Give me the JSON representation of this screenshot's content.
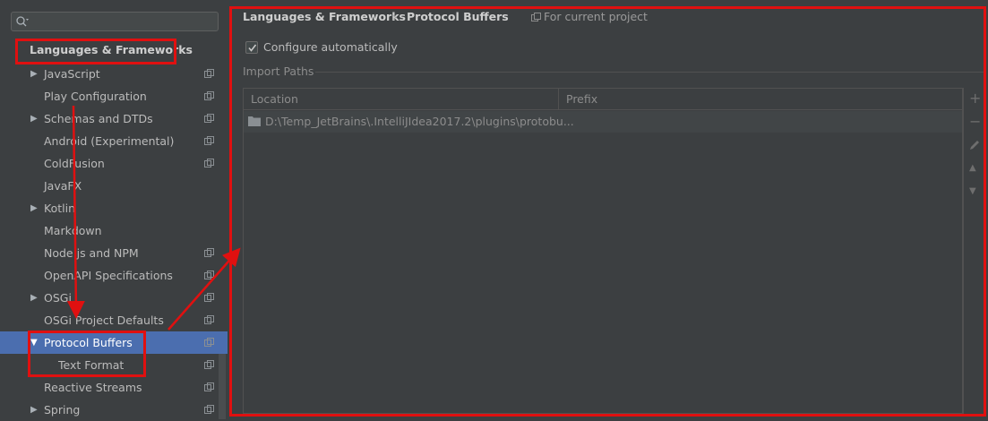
{
  "sidebar": {
    "search": {
      "placeholder": "",
      "value": ""
    },
    "root_label": "Languages & Frameworks",
    "items": [
      {
        "label": "JavaScript",
        "arrow": "▶",
        "project_icon": true
      },
      {
        "label": "Play Configuration",
        "arrow": "",
        "project_icon": true
      },
      {
        "label": "Schemas and DTDs",
        "arrow": "▶",
        "project_icon": true
      },
      {
        "label": "Android (Experimental)",
        "arrow": "",
        "project_icon": true
      },
      {
        "label": "ColdFusion",
        "arrow": "",
        "project_icon": true
      },
      {
        "label": "JavaFX",
        "arrow": "",
        "project_icon": false
      },
      {
        "label": "Kotlin",
        "arrow": "▶",
        "project_icon": false
      },
      {
        "label": "Markdown",
        "arrow": "",
        "project_icon": false
      },
      {
        "label": "Node.js and NPM",
        "arrow": "",
        "project_icon": true
      },
      {
        "label": "OpenAPI Specifications",
        "arrow": "",
        "project_icon": true
      },
      {
        "label": "OSGi",
        "arrow": "▶",
        "project_icon": true
      },
      {
        "label": "OSGi Project Defaults",
        "arrow": "",
        "project_icon": true
      },
      {
        "label": "Protocol Buffers",
        "arrow": "▼",
        "project_icon": true,
        "selected": true
      },
      {
        "label": "Text Format",
        "arrow": "",
        "project_icon": true,
        "indent": true
      },
      {
        "label": "Reactive Streams",
        "arrow": "",
        "project_icon": true
      },
      {
        "label": "Spring",
        "arrow": "▶",
        "project_icon": true
      }
    ]
  },
  "header": {
    "breadcrumb_parent": "Languages & Frameworks",
    "breadcrumb_separator": "›",
    "breadcrumb_current": "Protocol Buffers",
    "scope_label": "For current project"
  },
  "settings": {
    "configure_automatically_label": "Configure automatically",
    "configure_automatically_checked": true,
    "import_paths_title": "Import Paths"
  },
  "table": {
    "columns": [
      "Location",
      "Prefix"
    ],
    "rows": [
      {
        "location": "D:\\Temp_JetBrains\\.IntelliJIdea2017.2\\plugins\\protobu...",
        "prefix": ""
      }
    ]
  },
  "toolbar": {
    "add": "+",
    "remove": "−",
    "edit": "edit-icon",
    "move_up": "▲",
    "move_down": "▼"
  },
  "colors": {
    "background": "#3c3f41",
    "selection": "#4b6eaf",
    "annotation": "#e01010"
  }
}
